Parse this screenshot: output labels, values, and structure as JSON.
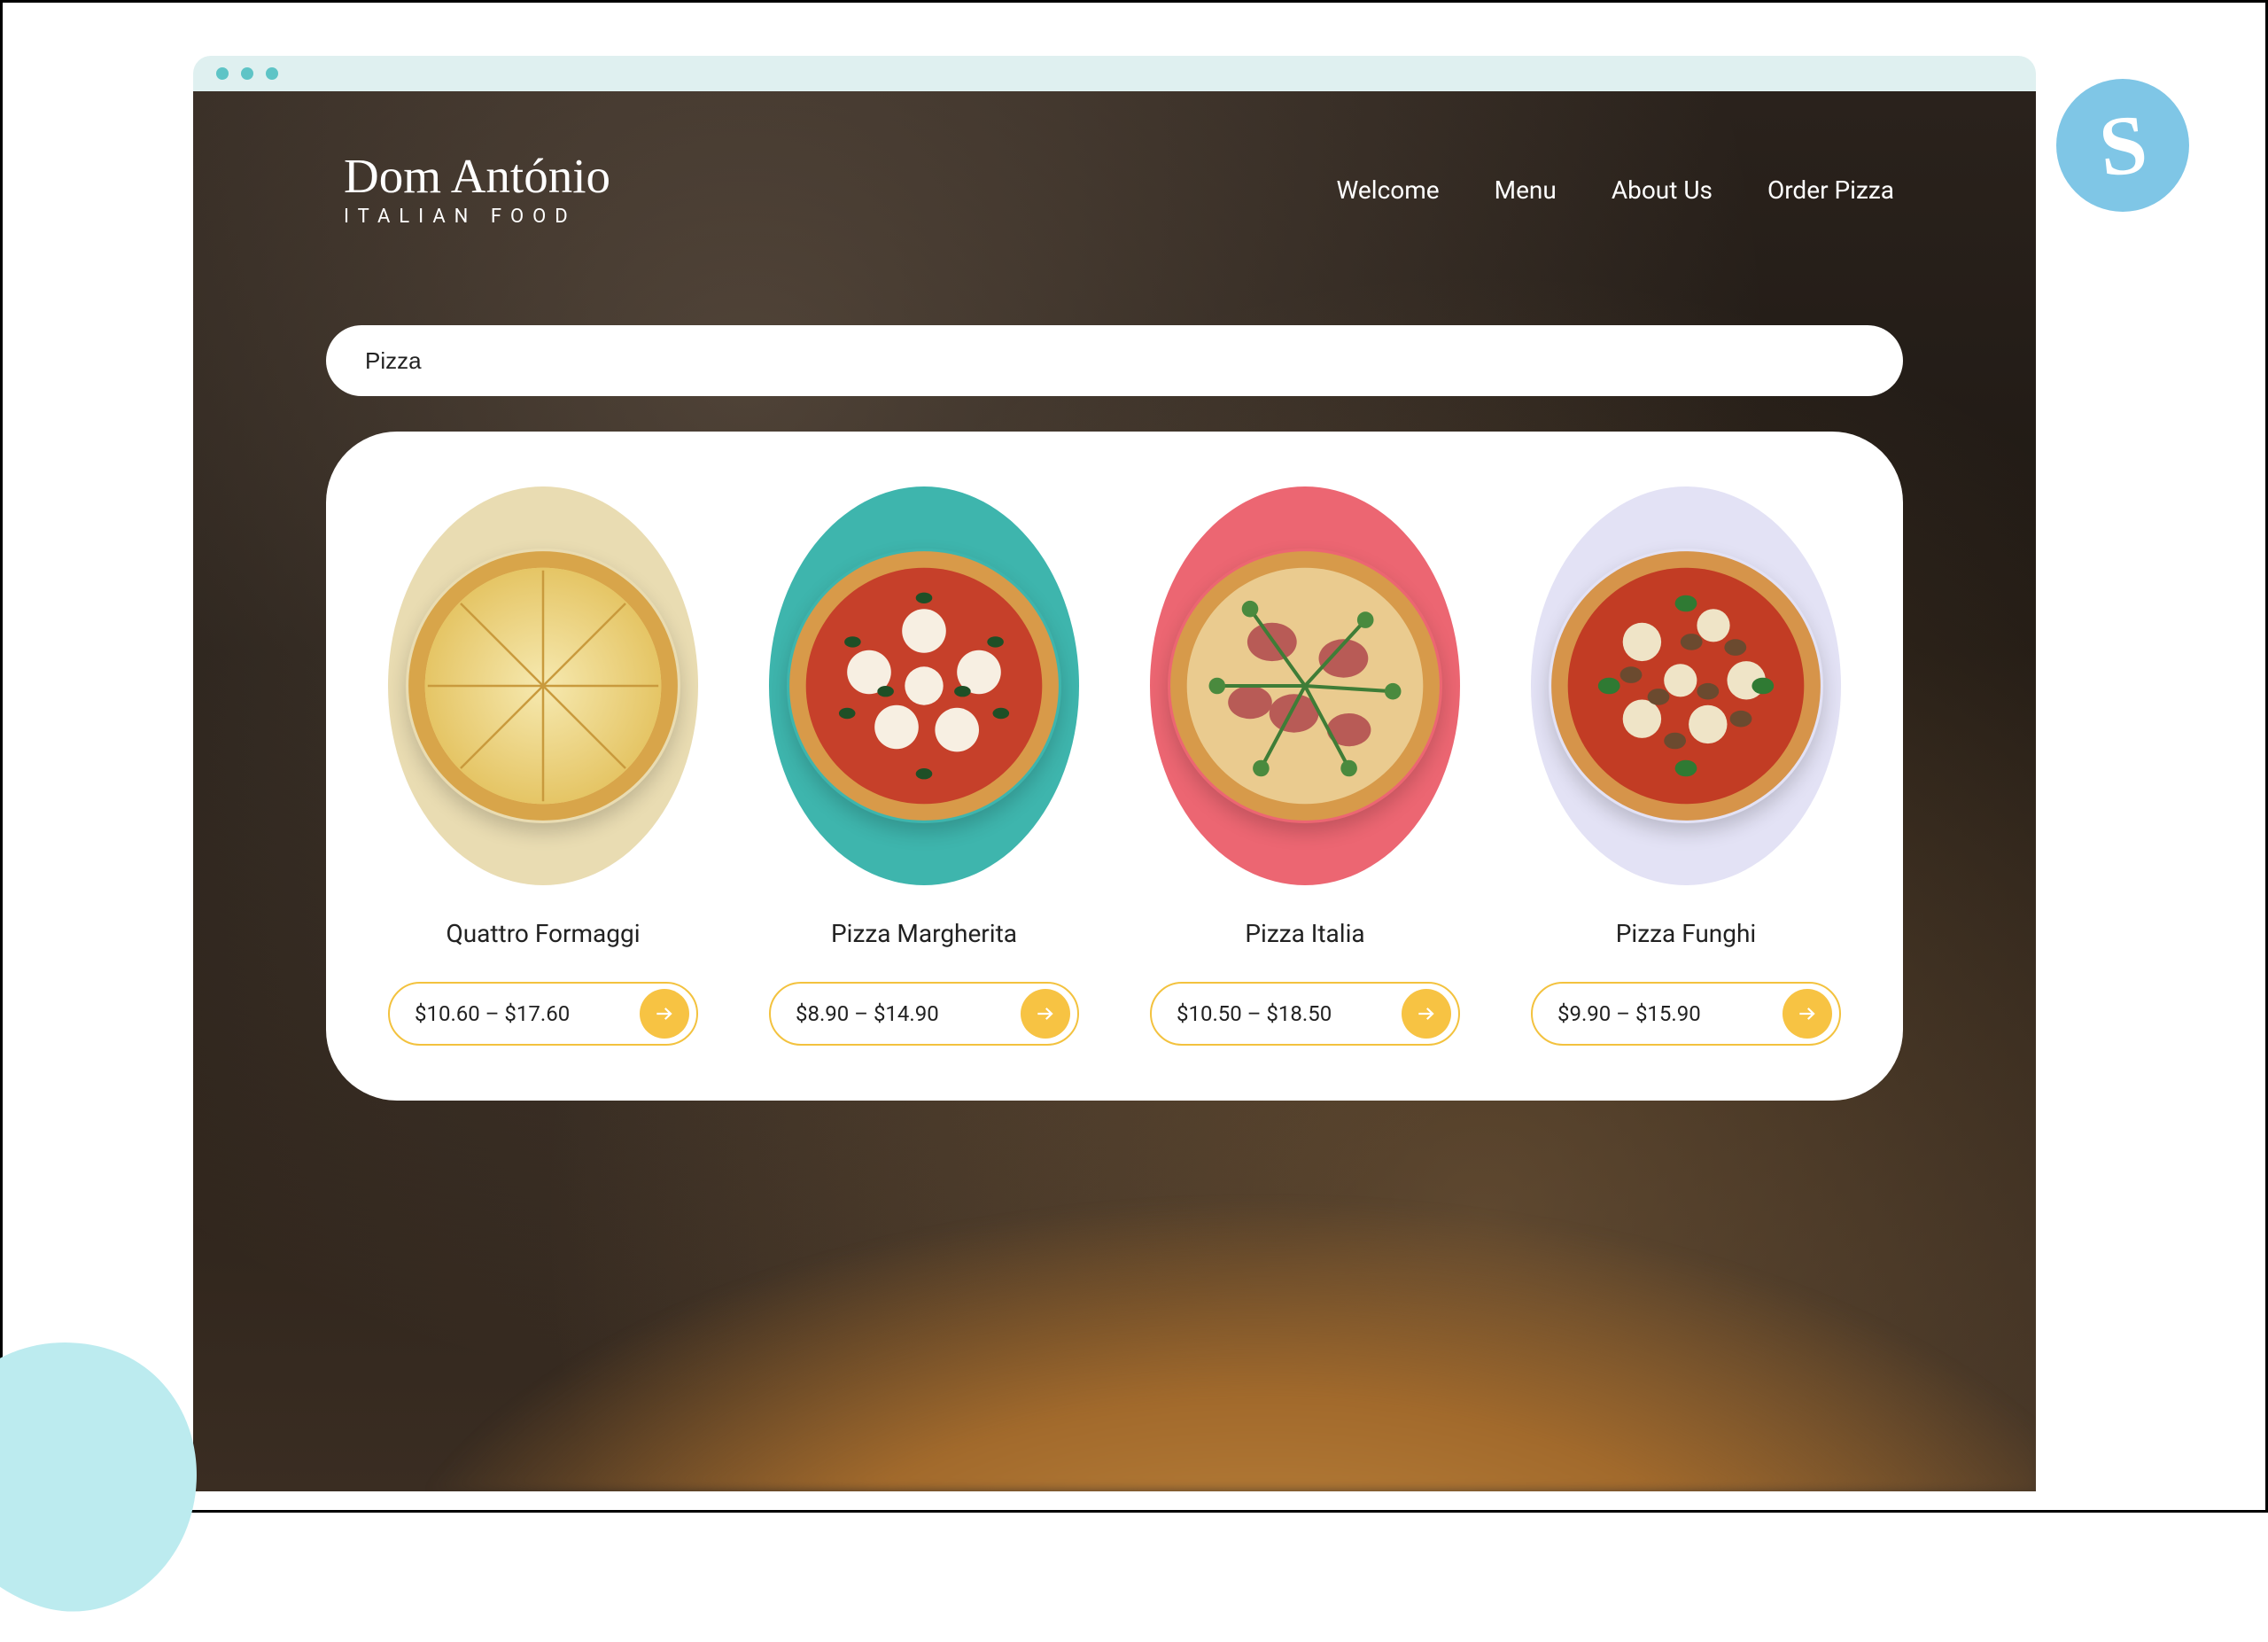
{
  "brand": {
    "name": "Dom António",
    "tagline": "ITALIAN FOOD"
  },
  "nav": {
    "items": [
      {
        "label": "Welcome"
      },
      {
        "label": "Menu"
      },
      {
        "label": "About Us"
      },
      {
        "label": "Order Pizza"
      }
    ]
  },
  "search": {
    "value": "Pizza"
  },
  "results": [
    {
      "name": "Quattro Formaggi",
      "price": "$10.60 – $17.60",
      "bg": "c1"
    },
    {
      "name": "Pizza Margherita",
      "price": "$8.90 – $14.90",
      "bg": "c2"
    },
    {
      "name": "Pizza Italia",
      "price": "$10.50 – $18.50",
      "bg": "c3"
    },
    {
      "name": "Pizza Funghi",
      "price": "$9.90 – $15.90",
      "bg": "c4"
    }
  ],
  "badge": {
    "letter": "S"
  }
}
